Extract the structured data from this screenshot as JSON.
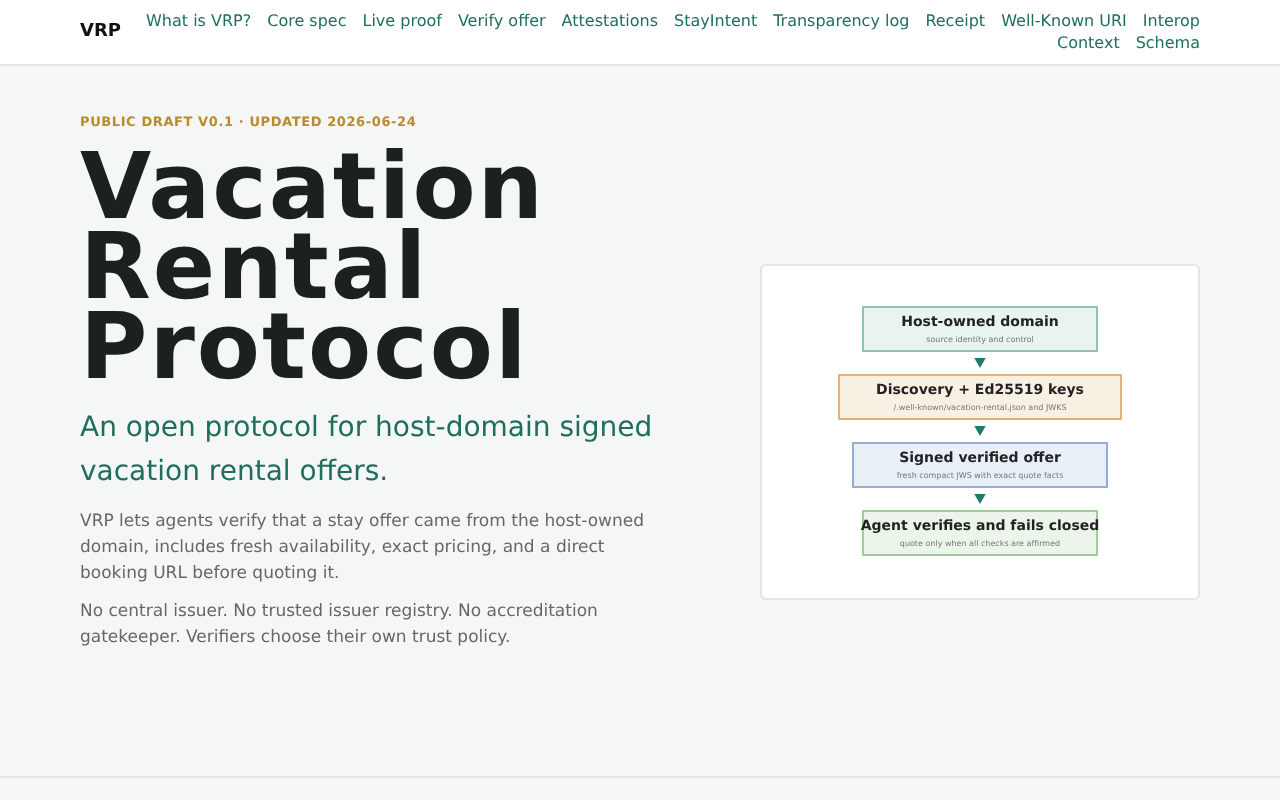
{
  "header": {
    "brand": "VRP",
    "nav": [
      {
        "label": "What is VRP?"
      },
      {
        "label": "Core spec"
      },
      {
        "label": "Live proof"
      },
      {
        "label": "Verify offer"
      },
      {
        "label": "Attestations"
      },
      {
        "label": "StayIntent"
      },
      {
        "label": "Transparency log"
      },
      {
        "label": "Receipt"
      },
      {
        "label": "Well-Known URI"
      },
      {
        "label": "Interop"
      },
      {
        "label": "Context"
      },
      {
        "label": "Schema"
      }
    ]
  },
  "hero": {
    "eyebrow": "PUBLIC DRAFT V0.1 · UPDATED 2026-06-24",
    "title": [
      "Vacation",
      "Rental",
      "Protocol"
    ],
    "lead": "An open protocol for host-domain signed vacation rental offers.",
    "paragraphs": [
      "VRP lets agents verify that a stay offer came from the host-owned domain, includes fresh availability, exact pricing, and a direct booking URL before quoting it.",
      "No central issuer. No trusted issuer registry. No accreditation gatekeeper. Verifiers choose their own trust policy."
    ]
  },
  "diagram": {
    "nodes": [
      {
        "title": "Host-owned domain",
        "subtitle": "source identity and control",
        "color": "#8fc4b4"
      },
      {
        "title": "Discovery + Ed25519 keys",
        "subtitle": "/.well-known/vacation-rental.json and JWKS",
        "color": "#e0b27a"
      },
      {
        "title": "Signed verified offer",
        "subtitle": "fresh compact JWS with exact quote facts",
        "color": "#93aed0"
      },
      {
        "title": "Agent verifies and fails closed",
        "subtitle": "quote only when all checks are affirmed",
        "color": "#9fcc98"
      }
    ]
  }
}
